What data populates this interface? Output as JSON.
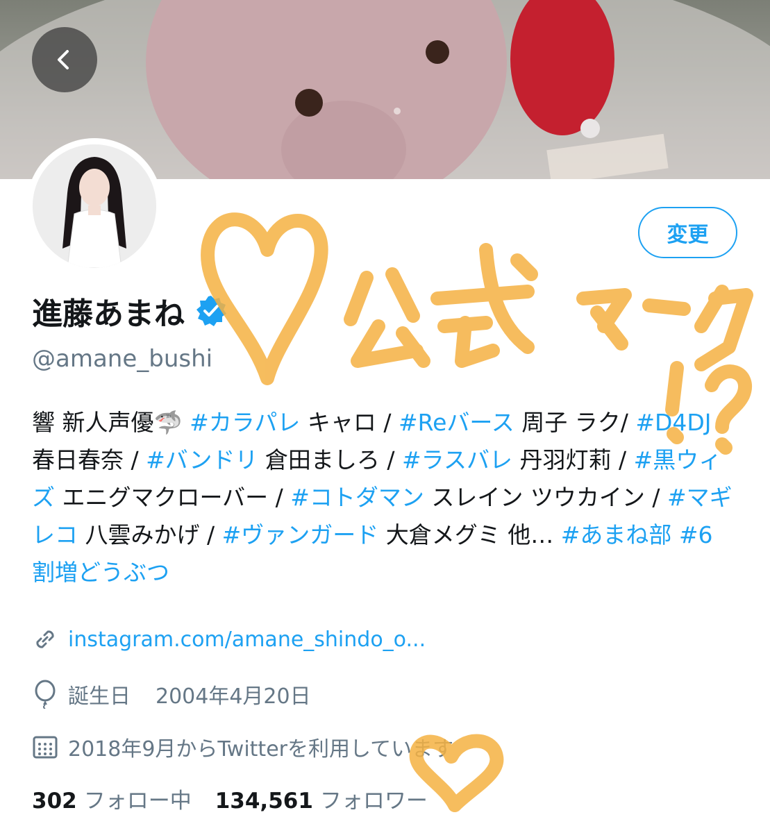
{
  "profile": {
    "display_name": "進藤あまね",
    "handle": "@amane_bushi",
    "edit_label": "変更",
    "bio": [
      {
        "text": "響 新人声優🦈 ",
        "tag": false
      },
      {
        "text": "#カラパレ",
        "tag": true
      },
      {
        "text": " キャロ / ",
        "tag": false
      },
      {
        "text": "#Reバース",
        "tag": true
      },
      {
        "text": " 周子 ラク/ ",
        "tag": false
      },
      {
        "text": "#D4DJ",
        "tag": true
      },
      {
        "text": " 春日春奈 / ",
        "tag": false
      },
      {
        "text": "#バンドリ",
        "tag": true
      },
      {
        "text": " 倉田ましろ / ",
        "tag": false
      },
      {
        "text": "#ラスバレ",
        "tag": true
      },
      {
        "text": " 丹羽灯莉 / ",
        "tag": false
      },
      {
        "text": "#黒ウィズ",
        "tag": true
      },
      {
        "text": " エニグマクローバー / ",
        "tag": false
      },
      {
        "text": "#コトダマン",
        "tag": true
      },
      {
        "text": " スレイン ツウカイン / ",
        "tag": false
      },
      {
        "text": "#マギレコ",
        "tag": true
      },
      {
        "text": " 八雲みかげ / ",
        "tag": false
      },
      {
        "text": "#ヴァンガード",
        "tag": true
      },
      {
        "text": " 大倉メグミ 他… ",
        "tag": false
      },
      {
        "text": "#あまね部",
        "tag": true
      },
      {
        "text": " ",
        "tag": false
      },
      {
        "text": "#6割増どうぶつ",
        "tag": true
      }
    ],
    "link": "instagram.com/amane_shindo_o...",
    "birthday_label": "誕生日",
    "birthday_value": "2004年4月20日",
    "joined": "2018年9月からTwitterを利用しています",
    "following_count": "302",
    "following_label": "フォロー中",
    "followers_count": "134,561",
    "followers_label": "フォロワー"
  },
  "icons": {
    "back": "chevron-left-icon",
    "verified": "verified-badge-icon",
    "link": "link-icon",
    "birthday": "balloon-icon",
    "joined": "calendar-icon"
  },
  "annotation": {
    "text": "公式マーク!?",
    "color": "#f5b142"
  },
  "colors": {
    "accent": "#1da1f2",
    "secondary_text": "#657786",
    "primary_text": "#14171a"
  }
}
